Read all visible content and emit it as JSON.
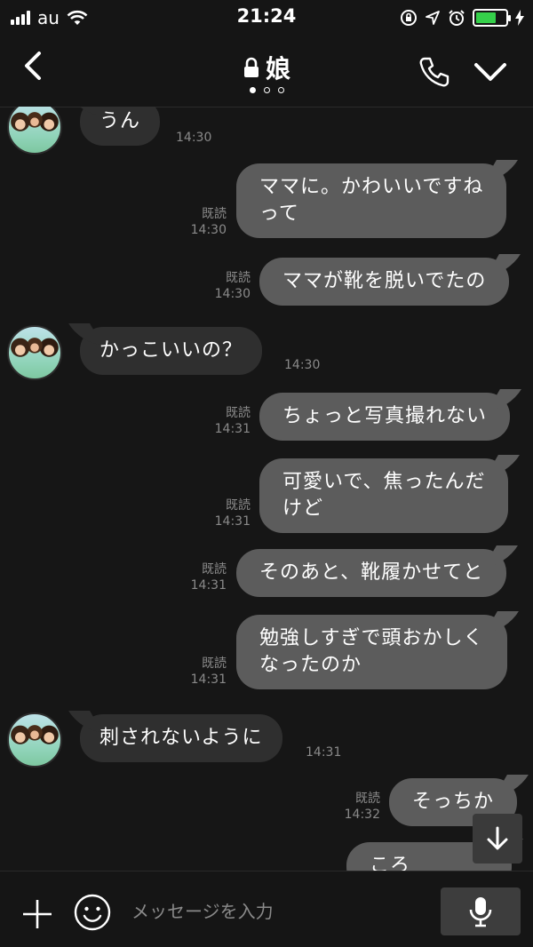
{
  "status_bar": {
    "carrier": "au",
    "time": "21:24",
    "battery_color": "#35d04a"
  },
  "header": {
    "title": "娘"
  },
  "messages": [
    {
      "side": "in",
      "text": "うん",
      "time": "14:30"
    },
    {
      "side": "out",
      "lines": [
        "ママに。かわいいですね",
        "って"
      ],
      "read": "既読",
      "time": "14:30"
    },
    {
      "side": "out",
      "text": "ママが靴を脱いでたの",
      "read": "既読",
      "time": "14:30"
    },
    {
      "side": "in",
      "text": "かっこいいの？",
      "time": "14:30"
    },
    {
      "side": "out",
      "text": "ちょっと写真撮れない",
      "read": "既読",
      "time": "14:31"
    },
    {
      "side": "out",
      "lines": [
        "可愛いで、焦ったんだ",
        "けど"
      ],
      "read": "既読",
      "time": "14:31"
    },
    {
      "side": "out",
      "text": "そのあと、靴履かせてと",
      "read": "既読",
      "time": "14:31"
    },
    {
      "side": "out",
      "lines": [
        "勉強しすぎで頭おかしく",
        "なったのか"
      ],
      "read": "既読",
      "time": "14:31"
    },
    {
      "side": "in",
      "text": "刺されないように",
      "time": "14:31"
    },
    {
      "side": "out",
      "text": "そっちか",
      "read": "既読",
      "time": "14:32"
    },
    {
      "side": "out",
      "text": "ころ"
    }
  ],
  "footer": {
    "placeholder": "メッセージを入力"
  },
  "icons": {
    "back": "chevron-left-icon",
    "lock": "lock-icon",
    "call": "phone-icon",
    "menu": "chevron-down-icon",
    "plus": "plus-icon",
    "emoji": "smiley-icon",
    "mic": "microphone-icon",
    "scroll": "arrow-down-icon"
  }
}
